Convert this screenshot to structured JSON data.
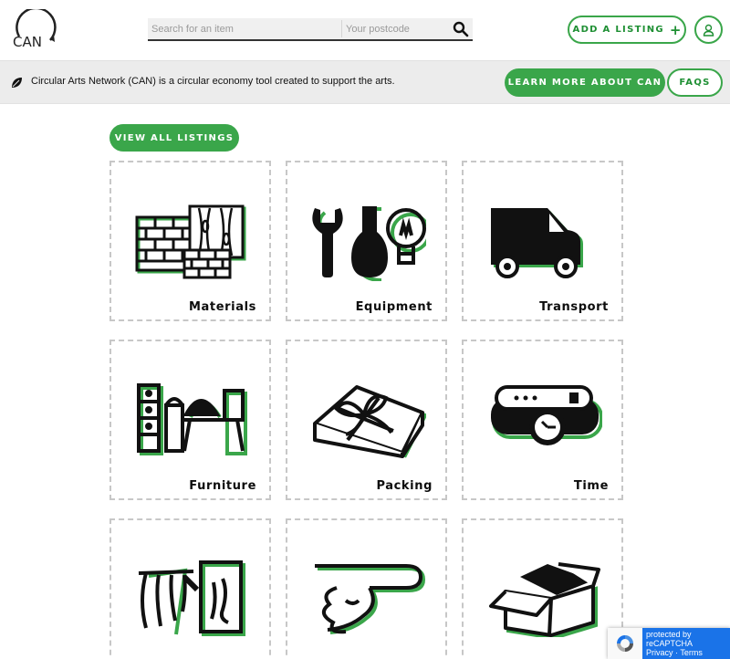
{
  "header": {
    "logo_text": "CAN",
    "search_placeholder": "Search for an item",
    "postcode_placeholder": "Your postcode",
    "add_listing_label": "ADD A LISTING",
    "add_listing_plus": "+"
  },
  "infobar": {
    "text": "Circular Arts Network (CAN) is a circular economy tool created to support the arts.",
    "learn_more_label": "LEARN MORE ABOUT CAN",
    "faqs_label": "FAQS"
  },
  "view_all_label": "VIEW ALL LISTINGS",
  "categories": [
    {
      "label": "Materials",
      "icon": "bricks-wood-icon"
    },
    {
      "label": "Equipment",
      "icon": "tools-vase-bulb-icon"
    },
    {
      "label": "Transport",
      "icon": "van-icon"
    },
    {
      "label": "Furniture",
      "icon": "furniture-icon"
    },
    {
      "label": "Packing",
      "icon": "gift-box-icon"
    },
    {
      "label": "Time",
      "icon": "wristwatch-icon"
    },
    {
      "label": "",
      "icon": "artwork-hand-icon"
    },
    {
      "label": "",
      "icon": "hand-icon"
    },
    {
      "label": "",
      "icon": "open-box-icon"
    }
  ],
  "recaptcha": {
    "line1": "protected by",
    "line2": "reCAPTCHA",
    "line3": "Privacy · Terms"
  },
  "colors": {
    "brand_green": "#3aa64a",
    "text_dark": "#111111",
    "infobar_bg": "#ececec"
  }
}
